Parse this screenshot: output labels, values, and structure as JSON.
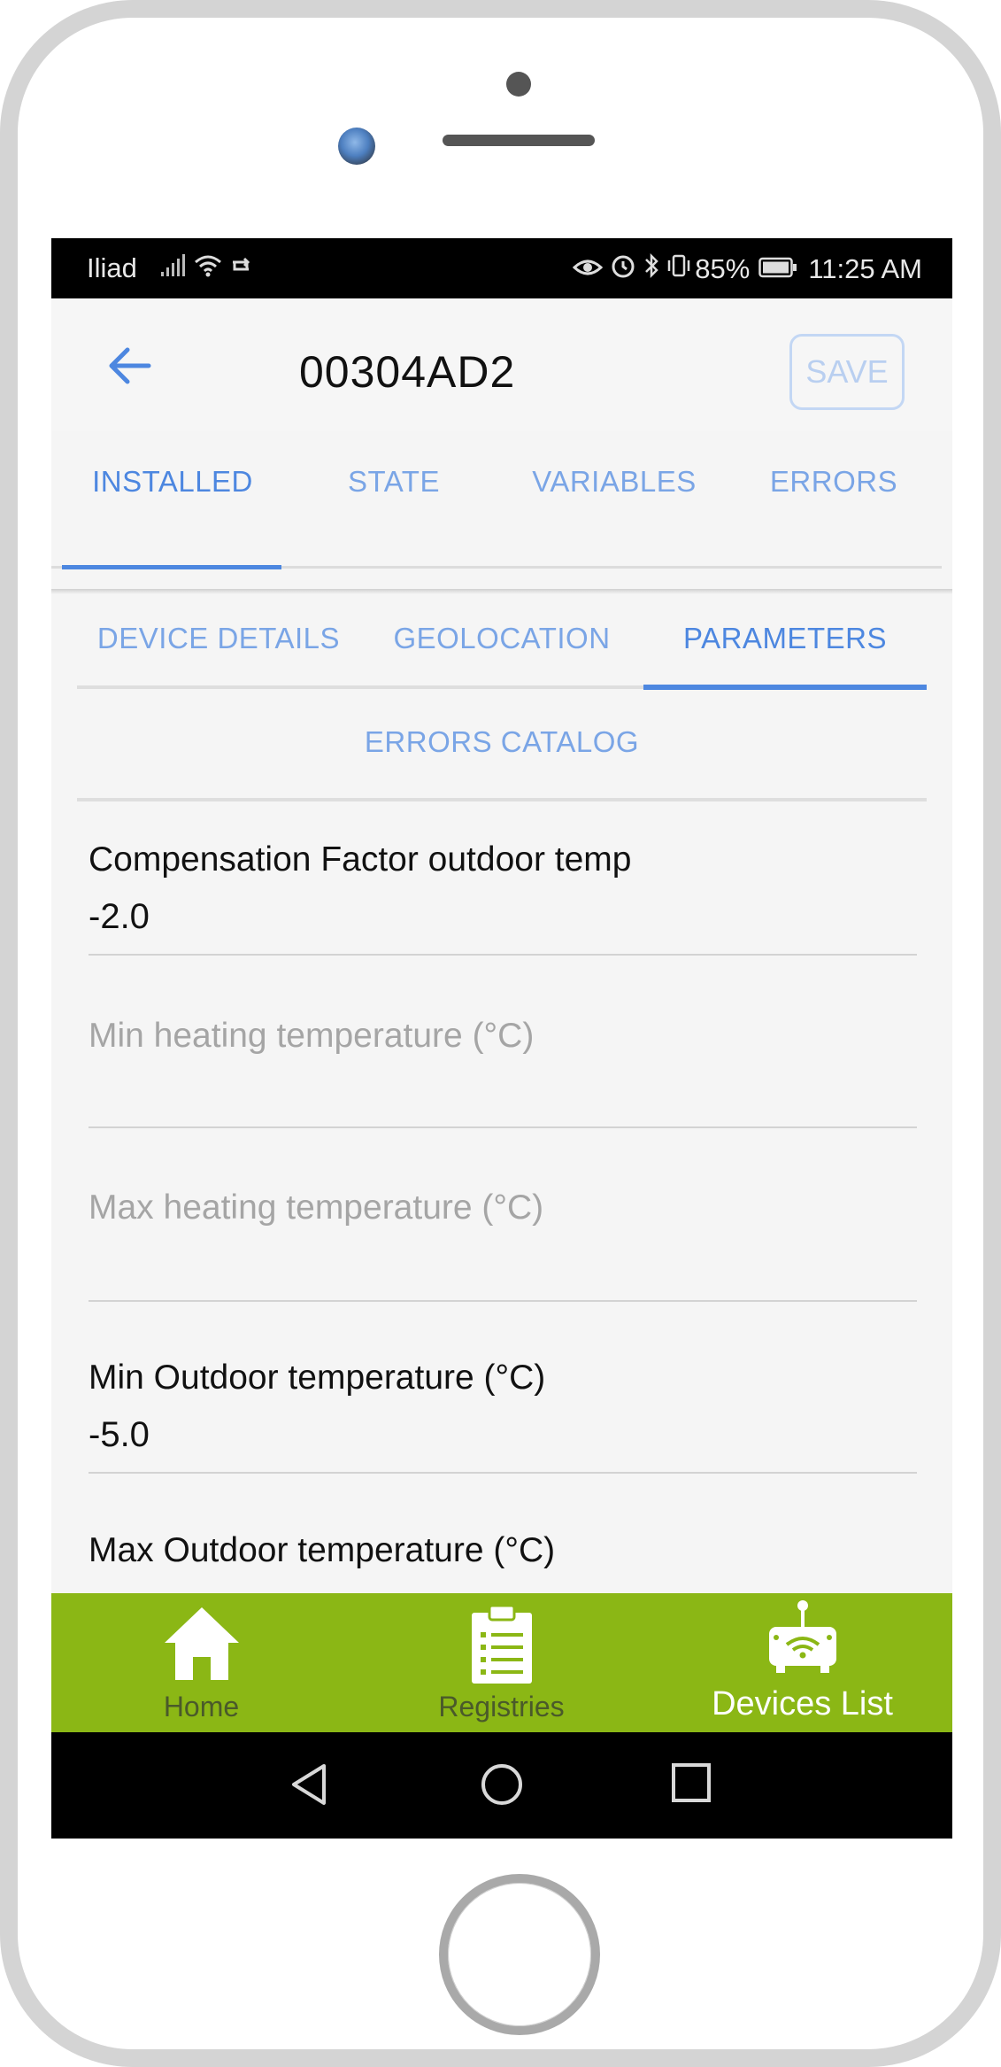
{
  "status_bar": {
    "carrier": "Iliad",
    "battery_percent": "85%",
    "time": "11:25 AM"
  },
  "app_bar": {
    "title": "00304AD2",
    "save_label": "SAVE"
  },
  "main_tabs": [
    {
      "label": "INSTALLED",
      "active": true
    },
    {
      "label": "STATE",
      "active": false
    },
    {
      "label": "VARIABLES",
      "active": false
    },
    {
      "label": "ERRORS",
      "active": false
    }
  ],
  "sub_tabs": [
    {
      "label": "DEVICE DETAILS",
      "active": false
    },
    {
      "label": "GEOLOCATION",
      "active": false
    },
    {
      "label": "PARAMETERS",
      "active": true
    },
    {
      "label": "ERRORS CATALOG",
      "active": false
    }
  ],
  "parameters": [
    {
      "label": "Compensation Factor outdoor temp",
      "value": "-2.0"
    },
    {
      "label": "Min heating temperature (°C)",
      "value": ""
    },
    {
      "label": "Max heating temperature (°C)",
      "value": ""
    },
    {
      "label": "Min Outdoor temperature (°C)",
      "value": "-5.0"
    },
    {
      "label": "Max Outdoor temperature (°C)",
      "value": ""
    }
  ],
  "bottom_nav": [
    {
      "label": "Home",
      "icon": "home-icon",
      "active": false
    },
    {
      "label": "Registries",
      "icon": "clipboard-icon",
      "active": false
    },
    {
      "label": "Devices List",
      "icon": "router-icon",
      "active": true
    }
  ],
  "colors": {
    "accent": "#4d87e0",
    "nav_bar": "#8bb715",
    "background": "#f5f5f5"
  }
}
